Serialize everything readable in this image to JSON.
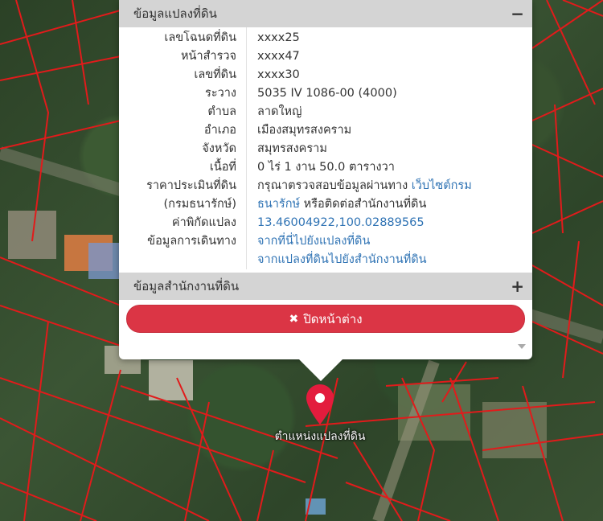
{
  "parcel_section": {
    "title": "ข้อมูลแปลงที่ดิน",
    "toggle": "−",
    "rows": [
      {
        "label": "เลขโฉนดที่ดิน",
        "value": "xxxx25"
      },
      {
        "label": "หน้าสำรวจ",
        "value": "xxxx47"
      },
      {
        "label": "เลขที่ดิน",
        "value": "xxxx30"
      },
      {
        "label": "ระวาง",
        "value": "5035 IV 1086-00 (4000)"
      },
      {
        "label": "ตำบล",
        "value": "ลาดใหญ่"
      },
      {
        "label": "อำเภอ",
        "value": "เมืองสมุทรสงคราม"
      },
      {
        "label": "จังหวัด",
        "value": "สมุทรสงคราม"
      },
      {
        "label": "เนื้อที่",
        "value": "0 ไร่ 1 งาน 50.0 ตารางวา"
      }
    ],
    "appraisal": {
      "label_line1": "ราคาประเมินที่ดิน",
      "label_line2": "(กรมธนารักษ์)",
      "text_line1_prefix": "กรุณาตรวจสอบข้อมูลผ่านทาง ",
      "link_line1": "เว็บไซต์กรม",
      "link_line2": "ธนารักษ์",
      "text_line2_suffix": " หรือติดต่อสำนักงานที่ดิน"
    },
    "coordinates": {
      "label": "ค่าพิกัดแปลง",
      "value": "13.46004922,100.02889565"
    },
    "directions": {
      "label": "ข้อมูลการเดินทาง",
      "link1": "จากที่นี่ไปยังแปลงที่ดิน",
      "link2": "จากแปลงที่ดินไปยังสำนักงานที่ดิน"
    }
  },
  "office_section": {
    "title": "ข้อมูลสำนักงานที่ดิน",
    "toggle": "+"
  },
  "close_button": {
    "icon": "✖",
    "label": "ปิดหน้าต่าง"
  },
  "map": {
    "marker_label": "ตำแหน่งแปลงที่ดิน",
    "marker_color": "#e31c3d"
  }
}
